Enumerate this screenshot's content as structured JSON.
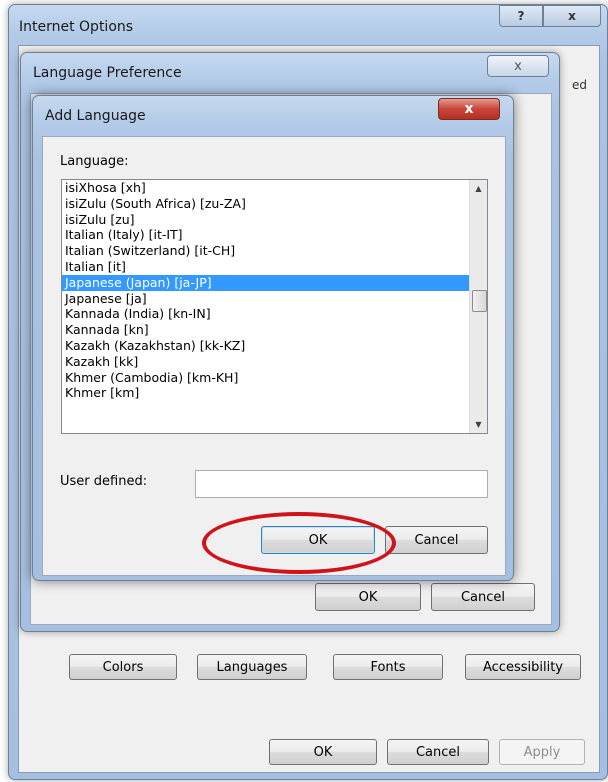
{
  "internet_options": {
    "title": "Internet Options",
    "help_button": "?",
    "close_button": "x",
    "tab_partial": "ed",
    "buttons": {
      "colors": "Colors",
      "languages": "Languages",
      "fonts": "Fonts",
      "accessibility": "Accessibility",
      "ok": "OK",
      "cancel": "Cancel",
      "apply": "Apply"
    }
  },
  "language_preference": {
    "title": "Language Preference",
    "close_button": "x",
    "ok": "OK",
    "cancel": "Cancel"
  },
  "add_language": {
    "title": "Add Language",
    "close_button": "x",
    "language_label": "Language:",
    "languages": [
      "isiXhosa [xh]",
      "isiZulu (South Africa) [zu-ZA]",
      "isiZulu [zu]",
      "Italian (Italy) [it-IT]",
      "Italian (Switzerland) [it-CH]",
      "Italian [it]",
      "Japanese (Japan) [ja-JP]",
      "Japanese [ja]",
      "Kannada (India) [kn-IN]",
      "Kannada [kn]",
      "Kazakh (Kazakhstan) [kk-KZ]",
      "Kazakh [kk]",
      "Khmer (Cambodia) [km-KH]",
      "Khmer [km]"
    ],
    "selected_language": "Japanese (Japan) [ja-JP]",
    "user_defined_label": "User defined:",
    "user_defined_value": "",
    "ok": "OK",
    "cancel": "Cancel"
  },
  "colors": {
    "selection": "#3399ff",
    "annotation": "#d0121b",
    "close_button": "#c9463d"
  },
  "icons": {
    "scroll_up": "scroll-up-arrow-icon",
    "scroll_down": "scroll-down-arrow-icon"
  }
}
